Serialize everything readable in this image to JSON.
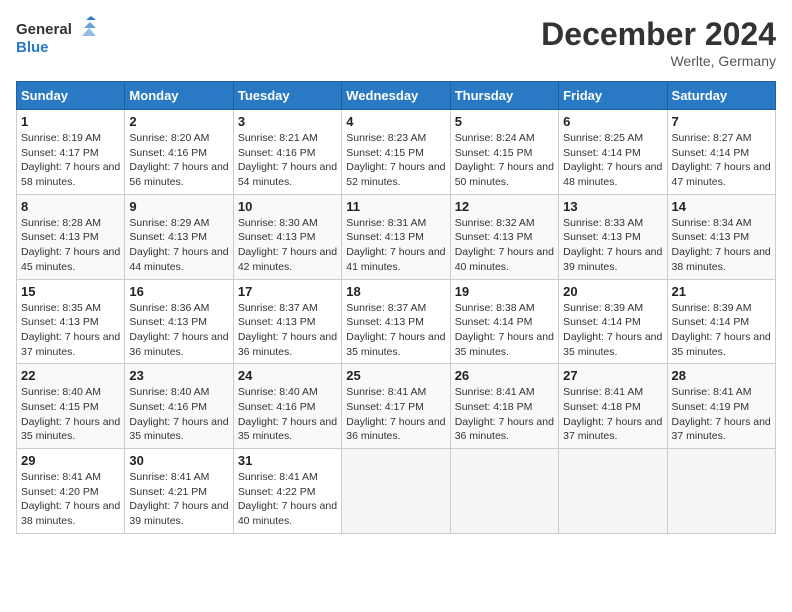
{
  "logo": {
    "text_general": "General",
    "text_blue": "Blue"
  },
  "title": "December 2024",
  "location": "Werlte, Germany",
  "days_of_week": [
    "Sunday",
    "Monday",
    "Tuesday",
    "Wednesday",
    "Thursday",
    "Friday",
    "Saturday"
  ],
  "weeks": [
    [
      {
        "day": "1",
        "sunrise": "8:19 AM",
        "sunset": "4:17 PM",
        "daylight": "7 hours and 58 minutes."
      },
      {
        "day": "2",
        "sunrise": "8:20 AM",
        "sunset": "4:16 PM",
        "daylight": "7 hours and 56 minutes."
      },
      {
        "day": "3",
        "sunrise": "8:21 AM",
        "sunset": "4:16 PM",
        "daylight": "7 hours and 54 minutes."
      },
      {
        "day": "4",
        "sunrise": "8:23 AM",
        "sunset": "4:15 PM",
        "daylight": "7 hours and 52 minutes."
      },
      {
        "day": "5",
        "sunrise": "8:24 AM",
        "sunset": "4:15 PM",
        "daylight": "7 hours and 50 minutes."
      },
      {
        "day": "6",
        "sunrise": "8:25 AM",
        "sunset": "4:14 PM",
        "daylight": "7 hours and 48 minutes."
      },
      {
        "day": "7",
        "sunrise": "8:27 AM",
        "sunset": "4:14 PM",
        "daylight": "7 hours and 47 minutes."
      }
    ],
    [
      {
        "day": "8",
        "sunrise": "8:28 AM",
        "sunset": "4:13 PM",
        "daylight": "7 hours and 45 minutes."
      },
      {
        "day": "9",
        "sunrise": "8:29 AM",
        "sunset": "4:13 PM",
        "daylight": "7 hours and 44 minutes."
      },
      {
        "day": "10",
        "sunrise": "8:30 AM",
        "sunset": "4:13 PM",
        "daylight": "7 hours and 42 minutes."
      },
      {
        "day": "11",
        "sunrise": "8:31 AM",
        "sunset": "4:13 PM",
        "daylight": "7 hours and 41 minutes."
      },
      {
        "day": "12",
        "sunrise": "8:32 AM",
        "sunset": "4:13 PM",
        "daylight": "7 hours and 40 minutes."
      },
      {
        "day": "13",
        "sunrise": "8:33 AM",
        "sunset": "4:13 PM",
        "daylight": "7 hours and 39 minutes."
      },
      {
        "day": "14",
        "sunrise": "8:34 AM",
        "sunset": "4:13 PM",
        "daylight": "7 hours and 38 minutes."
      }
    ],
    [
      {
        "day": "15",
        "sunrise": "8:35 AM",
        "sunset": "4:13 PM",
        "daylight": "7 hours and 37 minutes."
      },
      {
        "day": "16",
        "sunrise": "8:36 AM",
        "sunset": "4:13 PM",
        "daylight": "7 hours and 36 minutes."
      },
      {
        "day": "17",
        "sunrise": "8:37 AM",
        "sunset": "4:13 PM",
        "daylight": "7 hours and 36 minutes."
      },
      {
        "day": "18",
        "sunrise": "8:37 AM",
        "sunset": "4:13 PM",
        "daylight": "7 hours and 35 minutes."
      },
      {
        "day": "19",
        "sunrise": "8:38 AM",
        "sunset": "4:14 PM",
        "daylight": "7 hours and 35 minutes."
      },
      {
        "day": "20",
        "sunrise": "8:39 AM",
        "sunset": "4:14 PM",
        "daylight": "7 hours and 35 minutes."
      },
      {
        "day": "21",
        "sunrise": "8:39 AM",
        "sunset": "4:14 PM",
        "daylight": "7 hours and 35 minutes."
      }
    ],
    [
      {
        "day": "22",
        "sunrise": "8:40 AM",
        "sunset": "4:15 PM",
        "daylight": "7 hours and 35 minutes."
      },
      {
        "day": "23",
        "sunrise": "8:40 AM",
        "sunset": "4:16 PM",
        "daylight": "7 hours and 35 minutes."
      },
      {
        "day": "24",
        "sunrise": "8:40 AM",
        "sunset": "4:16 PM",
        "daylight": "7 hours and 35 minutes."
      },
      {
        "day": "25",
        "sunrise": "8:41 AM",
        "sunset": "4:17 PM",
        "daylight": "7 hours and 36 minutes."
      },
      {
        "day": "26",
        "sunrise": "8:41 AM",
        "sunset": "4:18 PM",
        "daylight": "7 hours and 36 minutes."
      },
      {
        "day": "27",
        "sunrise": "8:41 AM",
        "sunset": "4:18 PM",
        "daylight": "7 hours and 37 minutes."
      },
      {
        "day": "28",
        "sunrise": "8:41 AM",
        "sunset": "4:19 PM",
        "daylight": "7 hours and 37 minutes."
      }
    ],
    [
      {
        "day": "29",
        "sunrise": "8:41 AM",
        "sunset": "4:20 PM",
        "daylight": "7 hours and 38 minutes."
      },
      {
        "day": "30",
        "sunrise": "8:41 AM",
        "sunset": "4:21 PM",
        "daylight": "7 hours and 39 minutes."
      },
      {
        "day": "31",
        "sunrise": "8:41 AM",
        "sunset": "4:22 PM",
        "daylight": "7 hours and 40 minutes."
      },
      null,
      null,
      null,
      null
    ]
  ],
  "labels": {
    "sunrise": "Sunrise:",
    "sunset": "Sunset:",
    "daylight": "Daylight:"
  }
}
